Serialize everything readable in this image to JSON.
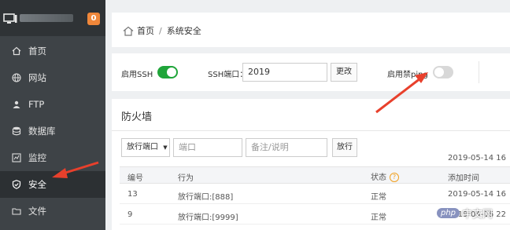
{
  "sidebar": {
    "badge": "0",
    "items": [
      {
        "label": "首页",
        "icon": "home-icon"
      },
      {
        "label": "网站",
        "icon": "globe-icon"
      },
      {
        "label": "FTP",
        "icon": "user-group-icon"
      },
      {
        "label": "数据库",
        "icon": "database-icon"
      },
      {
        "label": "监控",
        "icon": "monitor-chart-icon"
      },
      {
        "label": "安全",
        "icon": "shield-icon",
        "active": true
      },
      {
        "label": "文件",
        "icon": "folder-icon"
      }
    ]
  },
  "breadcrumb": {
    "home": "首页",
    "separator": "/",
    "current": "系统安全"
  },
  "settings": {
    "ssh_label": "启用SSH",
    "ssh_enabled": true,
    "port_label": "SSH端口：",
    "port_value": "2019",
    "change_button": "更改",
    "ping_label": "启用禁ping",
    "ping_disabled": false
  },
  "firewall": {
    "title": "防火墙",
    "select_value": "放行端口",
    "port_placeholder": "端口",
    "note_placeholder": "备注/说明",
    "add_button": "放行",
    "top_date": "2019-05-14 16",
    "columns": {
      "id": "编号",
      "action": "行为",
      "status": "状态",
      "time": "添加时间"
    },
    "rows": [
      {
        "id": "13",
        "action": "放行端口:[888]",
        "status": "正常",
        "time": "2019-05-14 16"
      },
      {
        "id": "9",
        "action": "放行端口:[9999]",
        "status": "正常",
        "time": "2019-04-16 22"
      }
    ]
  },
  "watermark": {
    "badge": "php",
    "text": "中文网"
  },
  "colors": {
    "sidebar": "#3e4347",
    "toggle_on": "#20a53a",
    "badge": "#f0873a",
    "arrow": "#e8402c"
  }
}
